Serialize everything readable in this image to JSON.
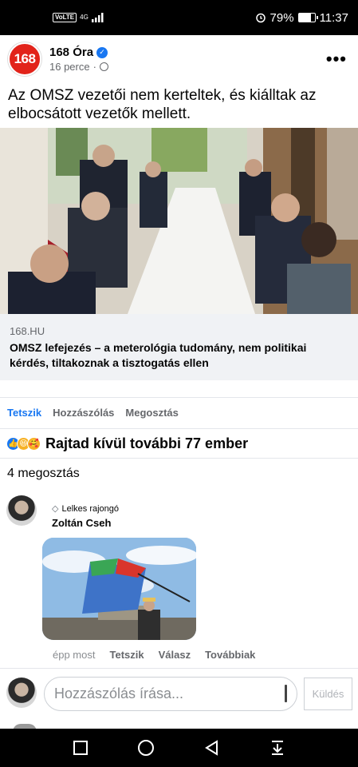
{
  "status_bar": {
    "volte": "VoLTE",
    "network": "4G",
    "battery": "79%",
    "battery_level": 0.79,
    "time": "11:37"
  },
  "post": {
    "page_logo": "168",
    "page_name": "168 Óra",
    "time": "16 perce",
    "separator": "·",
    "more_icon": "more-horizontal-icon",
    "text": "Az OMSZ vezetői nem kerteltek, és kiálltak az elbocsátott vezetők mellett."
  },
  "link_preview": {
    "domain": "168.HU",
    "title": "OMSZ lefejezés – a meterológia tudomány, nem politikai kérdés, tiltakoznak a tisztogatás ellen"
  },
  "actions": {
    "like": "Tetszik",
    "comment": "Hozzászólás",
    "share": "Megosztás"
  },
  "reactions": {
    "icons": [
      "like-icon",
      "haha-icon",
      "care-icon"
    ],
    "text": "Rajtad kívül további 77 ember"
  },
  "shares": "4 megosztás",
  "comment": {
    "badge": "Lelkes rajongó",
    "author": "Zoltán Cseh",
    "time": "épp most",
    "like": "Tetszik",
    "reply": "Válasz",
    "more": "Továbbiak"
  },
  "composer": {
    "placeholder": "Hozzászólás írása...",
    "send": "Küldés"
  },
  "colors": {
    "accent": "#1877f2",
    "logo_red": "#e2231a"
  }
}
